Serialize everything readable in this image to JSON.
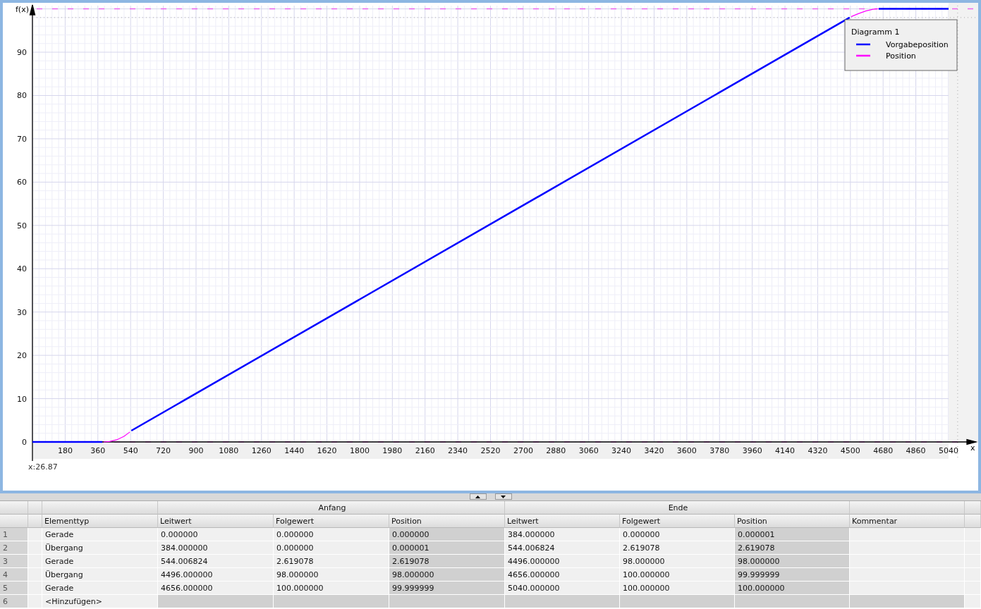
{
  "chart": {
    "cursor_readout": "x:26.87",
    "chart_data": {
      "type": "line",
      "title": "Diagramm 1",
      "xlabel": "x",
      "ylabel": "f(x)",
      "grid": true,
      "legend": "upper right",
      "x": [
        0,
        384,
        392,
        424,
        464,
        504,
        536,
        544,
        4496,
        4504,
        4544,
        4584,
        4624,
        4648,
        4656,
        5040
      ],
      "series": [
        {
          "name": "Vorgabeposition",
          "color": "#0000ff",
          "values": [
            0,
            0,
            null,
            null,
            null,
            null,
            null,
            2.6,
            98,
            null,
            null,
            null,
            null,
            null,
            100,
            100
          ]
        },
        {
          "name": "Position",
          "color": "#ff00ff",
          "values": [
            null,
            null,
            0,
            0.1,
            0.5,
            1.3,
            2.3,
            null,
            null,
            98.2,
            98.9,
            99.5,
            99.9,
            100,
            null,
            null
          ]
        }
      ],
      "ref_lines": [
        {
          "axis": "y",
          "value": 100,
          "color": "#ee66ee"
        },
        {
          "axis": "y",
          "value": 0,
          "color": "#ee66ee"
        },
        {
          "axis": "y",
          "value": 98,
          "color": "#aaaaaa"
        },
        {
          "axis": "x",
          "value": 5090,
          "color": "#aaaaaa"
        }
      ],
      "xlim": [
        0,
        5040
      ],
      "ylim": [
        0,
        100
      ],
      "xticks": [
        180,
        360,
        540,
        720,
        900,
        1080,
        1260,
        1440,
        1620,
        1800,
        1980,
        2160,
        2340,
        2520,
        2700,
        2880,
        3060,
        3240,
        3420,
        3600,
        3780,
        3960,
        4140,
        4320,
        4500,
        4680,
        4860,
        5040
      ],
      "yticks": [
        0,
        10,
        20,
        30,
        40,
        50,
        60,
        70,
        80,
        90
      ]
    }
  },
  "table": {
    "group_headers": [
      {
        "label": "Anfang"
      },
      {
        "label": "Ende"
      }
    ],
    "columns": [
      {
        "label": "Elementtyp",
        "readonly": false
      },
      {
        "label": "Leitwert",
        "readonly": false
      },
      {
        "label": "Folgewert",
        "readonly": false
      },
      {
        "label": "Position",
        "readonly": true
      },
      {
        "label": "Leitwert",
        "readonly": false
      },
      {
        "label": "Folgewert",
        "readonly": false
      },
      {
        "label": "Position",
        "readonly": true
      },
      {
        "label": "Kommentar",
        "readonly": false
      }
    ],
    "rows": [
      {
        "number": "1",
        "kind": "element",
        "cells": [
          "Gerade",
          "0.000000",
          "0.000000",
          "0.000000",
          "384.000000",
          "0.000000",
          "0.000001"
        ]
      },
      {
        "number": "2",
        "kind": "element",
        "cells": [
          "Übergang",
          "384.000000",
          "0.000000",
          "0.000001",
          "544.006824",
          "2.619078",
          "2.619078"
        ]
      },
      {
        "number": "3",
        "kind": "element",
        "cells": [
          "Gerade",
          "544.006824",
          "2.619078",
          "2.619078",
          "4496.000000",
          "98.000000",
          "98.000000"
        ]
      },
      {
        "number": "4",
        "kind": "element",
        "cells": [
          "Übergang",
          "4496.000000",
          "98.000000",
          "98.000000",
          "4656.000000",
          "100.000000",
          "99.999999"
        ]
      },
      {
        "number": "5",
        "kind": "element",
        "cells": [
          "Gerade",
          "4656.000000",
          "100.000000",
          "99.999999",
          "5040.000000",
          "100.000000",
          "100.000000"
        ]
      },
      {
        "number": "6",
        "kind": "add",
        "cells": [
          "<Hinzufügen>"
        ]
      }
    ]
  }
}
